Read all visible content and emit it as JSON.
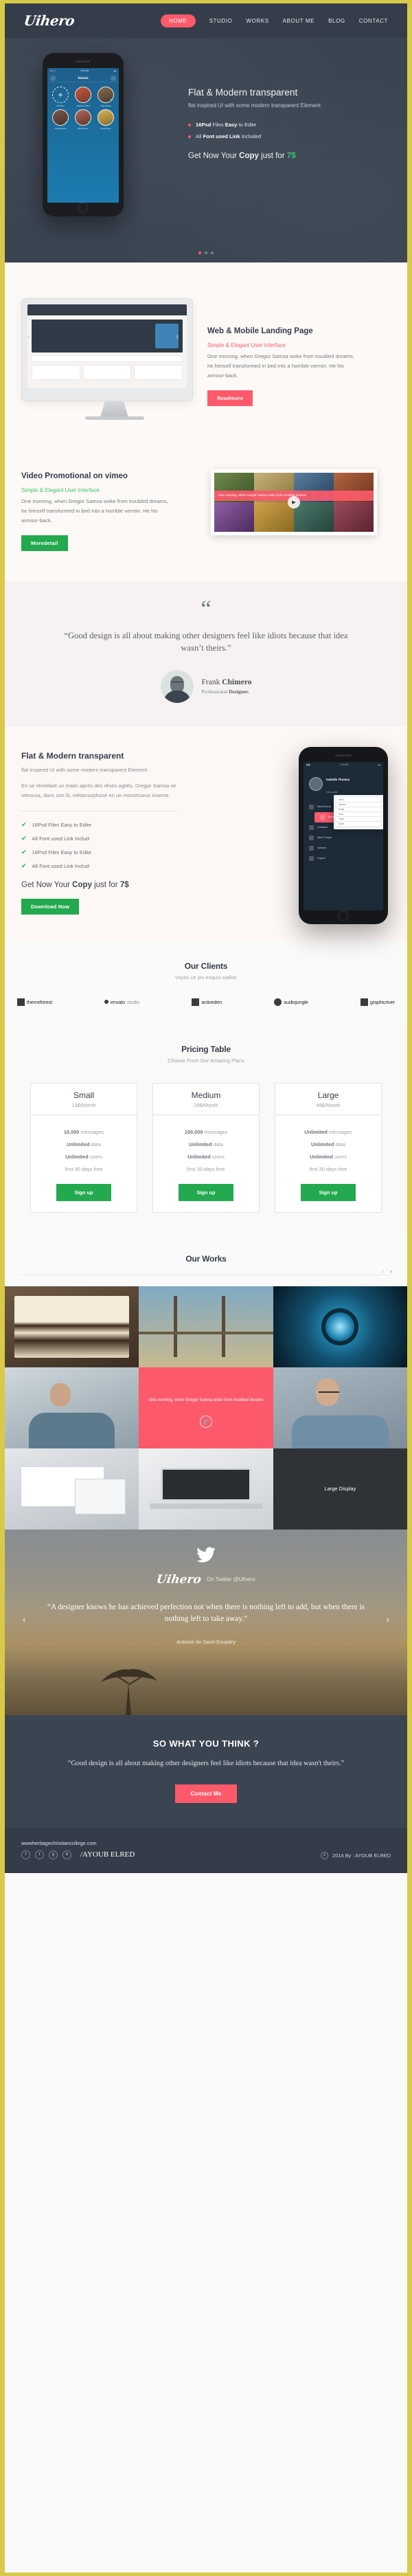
{
  "brand": {
    "logo": "Uihero",
    "accent_pink": "#fc5a6b",
    "accent_green": "#23a94e",
    "dark": "#3b4552",
    "frame": "#d9c948"
  },
  "nav": {
    "items": [
      {
        "label": "HOME",
        "active": true
      },
      {
        "label": "STUDIO",
        "active": false
      },
      {
        "label": "WORKS",
        "active": false
      },
      {
        "label": "ABOUT ME",
        "active": false
      },
      {
        "label": "BLOG",
        "active": false
      },
      {
        "label": "CONTACT",
        "active": false
      }
    ]
  },
  "hero": {
    "title": "Flat & Modern transparent",
    "subtitle": "flat inspired UI with some modern transparent Element",
    "bullets": [
      {
        "pre": "16Psd",
        "mid": " Files ",
        "bold": "Easy",
        "post": " to Edite"
      },
      {
        "pre": "All",
        "mid": " Font ",
        "bold": "used Link",
        "post": " Included"
      }
    ],
    "cta_pre": "Get Now Your ",
    "cta_bold": "Copy",
    "cta_mid": " just for ",
    "cta_price": "7$",
    "phone": {
      "status_left": "•••• ?",
      "status_time": "9:30 AM",
      "bar_title": "friends",
      "tiles": [
        {
          "name": "Add New",
          "add": true
        },
        {
          "name": "Chandra Collins",
          "color": "#c2563f"
        },
        {
          "name": "Thais Marito",
          "color": "#8a6a50"
        },
        {
          "name": "Juana Adams",
          "color": "#7d5a4a"
        },
        {
          "name": "Lilly Pearson",
          "color": "#b06a5a"
        },
        {
          "name": "Karla Moore",
          "color": "#d6b35c"
        }
      ]
    },
    "slider_dots": 3,
    "slider_active": 0
  },
  "landing": {
    "title": "Web & Mobile Landing Page",
    "tagline": "Simple & Elegant User Interface",
    "body": "One morning, when Gregor Samsa woke from troubled dreams, he himself transformed in bed into a horrible vermin. He  his armour-back.",
    "button": "Readmore"
  },
  "video": {
    "title": "Video Promotional on vimeo",
    "tagline": "Simple & Elegant User Interface",
    "body": "One morning, when Gregor Samsa woke from troubled dreams, he himself transformed in bed into a horrible vermin. He  his armour-back.",
    "button": "Moredetail",
    "thumb_caption": "One morning, when Gregor Samsa woke from troubled dreams"
  },
  "testimonial": {
    "quote_mark": "“",
    "quote": "“Good design is all about making other designers feel like idiots because that idea wasn’t theirs.”",
    "name_first": "Frank ",
    "name_last": "Chimero",
    "role_pre": "Professional ",
    "role_bold": "Designer."
  },
  "features": {
    "title": "Flat & Modern transparent",
    "subtitle": "flat inspired UI with some modern transparent Element",
    "paragraph": "En se réveillant un matin après des rêves agités, Gregor Samsa se retrouva, dans son lit, métamorphosé en un monstrueux insecte.",
    "list": [
      "16Psd Files Easy to Edite",
      "All Font used Link Includ-",
      "16Psd Files Easy to Edite",
      "All Font used Link Includ-"
    ],
    "cta_pre": "Get Now Your ",
    "cta_bold": "Copy",
    "cta_mid": " just for ",
    "cta_price": "7$",
    "button": "Download Now",
    "phone": {
      "status_time": "9:30 AM",
      "profile_name": "Isabella Thomas",
      "profile_sub": "View profile",
      "menu": [
        {
          "label": "New Events",
          "active": false
        },
        {
          "label": "Messages",
          "active": true
        },
        {
          "label": "Contacts",
          "active": false
        },
        {
          "label": "Multi People",
          "active": false
        },
        {
          "label": "Options",
          "active": false
        },
        {
          "label": "Logout",
          "active": false
        }
      ],
      "card_rows": [
        "Inbox",
        "Starred",
        "Drafts",
        "Sent",
        "Trash",
        "Spam"
      ]
    }
  },
  "clients": {
    "title": "Our Clients",
    "subtitle": "Voyez ce jeu exquis wallon",
    "logos": [
      {
        "name": "themeforest",
        "grey_part": ""
      },
      {
        "name": "envato",
        "grey_part": "studio"
      },
      {
        "name": "activeden",
        "grey_part": ""
      },
      {
        "name": "audiojungle",
        "grey_part": ""
      },
      {
        "name": "graphicriver",
        "grey_part": ""
      }
    ]
  },
  "pricing": {
    "title": "Pricing Table",
    "subtitle": "Choose From Our Amazing Plans",
    "plans": [
      {
        "name": "Small",
        "price": "19$/Month",
        "features": [
          {
            "bold": "10,000",
            "rest": " messages"
          },
          {
            "bold": "Unlimited",
            "rest": " data"
          },
          {
            "bold": "Unlimited",
            "rest": " users"
          },
          {
            "bold": "",
            "rest": "first 30 days free"
          }
        ],
        "button": "Sign up"
      },
      {
        "name": "Medium",
        "price": "29$/Month",
        "features": [
          {
            "bold": "100,000",
            "rest": " messages"
          },
          {
            "bold": "Unlimited",
            "rest": " data"
          },
          {
            "bold": "Unlimited",
            "rest": " users"
          },
          {
            "bold": "",
            "rest": "first 30 days free"
          }
        ],
        "button": "Sign up"
      },
      {
        "name": "Large",
        "price": "49$/Month",
        "features": [
          {
            "bold": "Unlimited",
            "rest": " messages"
          },
          {
            "bold": "Unlimited",
            "rest": " data"
          },
          {
            "bold": "Unlimited",
            "rest": " users"
          },
          {
            "bold": "",
            "rest": "first 30 days free"
          }
        ],
        "button": "Sign up"
      }
    ]
  },
  "works": {
    "title": "Our Works",
    "prev": "‹",
    "next": "›",
    "items": [
      {
        "kind": "photo-dessert",
        "label": ""
      },
      {
        "kind": "photo-bridge",
        "label": ""
      },
      {
        "kind": "photo-lens",
        "label": ""
      },
      {
        "kind": "photo-man-laptop",
        "label": ""
      },
      {
        "kind": "overlay-pink",
        "label": "One morning, when Gregor Samsa woke from troubled dreams"
      },
      {
        "kind": "photo-man-glasses",
        "label": ""
      },
      {
        "kind": "photo-screens",
        "label": ""
      },
      {
        "kind": "photo-laptop",
        "label": ""
      },
      {
        "kind": "dark-display",
        "label": "Large Display"
      }
    ]
  },
  "twitter": {
    "logo": "Uihero",
    "on_twitter": "On Twitter @UIhero",
    "quote": "“A designer knows he has achieved perfection not when there is nothing left to add, but when there is nothing left to take away.”",
    "author": "Antoine de Saint-Exupéry",
    "prev": "‹",
    "next": "›"
  },
  "cta": {
    "title": "SO WHAT YOU THINK ?",
    "quote": "“Good design is all about making other designers feel like idiots because that idea wasn't theirs.”",
    "button": "Contact Me"
  },
  "footer": {
    "url": "wwwheritagechristiancollege.com",
    "social": [
      "f",
      "t",
      "g",
      "b"
    ],
    "name": "/AYOUB ELRED",
    "copyright": "2014  By : AYOUB ELRED",
    "copy_symbol": "c"
  }
}
